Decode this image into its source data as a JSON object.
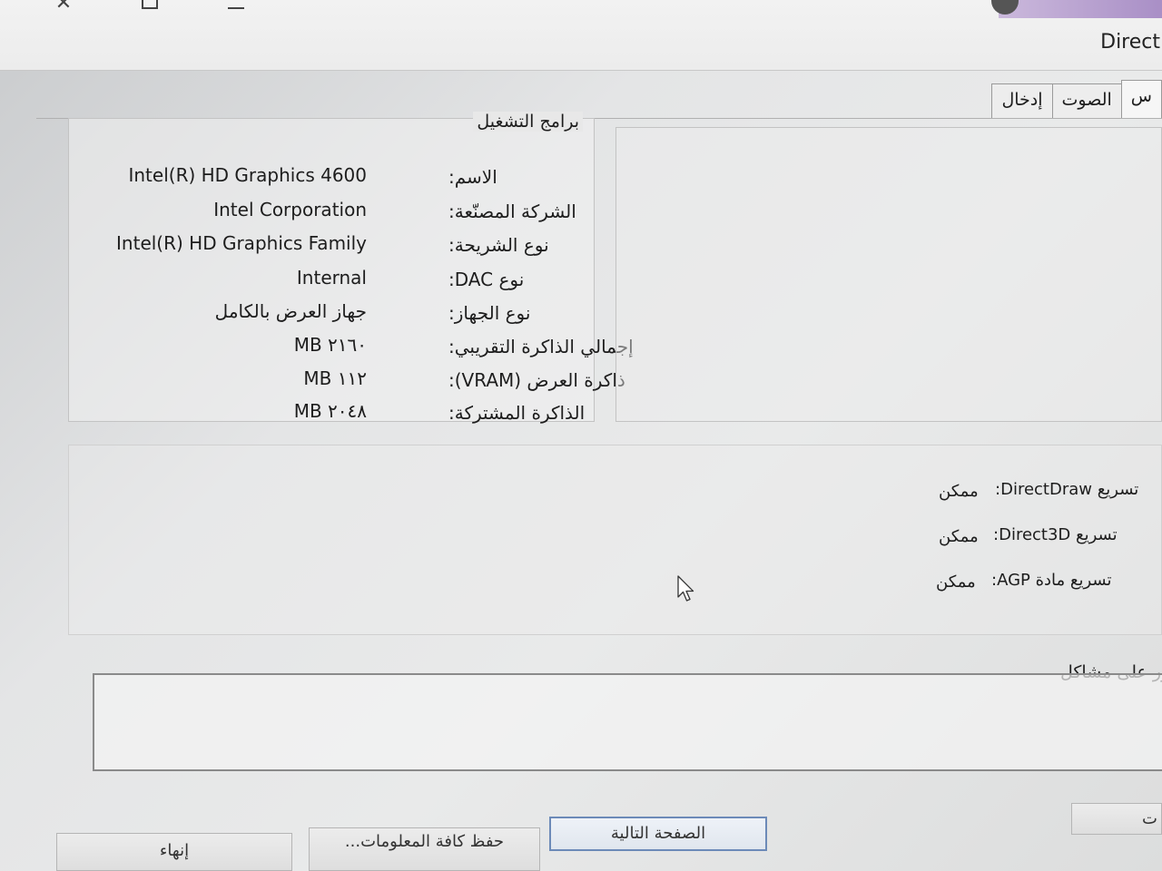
{
  "window": {
    "title": "Direct",
    "close_glyph": "✕"
  },
  "tabs": [
    {
      "label": "س",
      "active": true
    },
    {
      "label": "الصوت",
      "active": false
    },
    {
      "label": "إدخال",
      "active": false
    }
  ],
  "drivers": {
    "title": "برامج التشغيل",
    "rows": [
      {
        "label": "الاسم:",
        "value": "Intel(R) HD Graphics 4600"
      },
      {
        "label": "الشركة المصنّعة:",
        "value": "Intel Corporation"
      },
      {
        "label": "نوع الشريحة:",
        "value": "Intel(R) HD Graphics Family"
      },
      {
        "label": "نوع DAC:",
        "value": "Internal"
      },
      {
        "label": "نوع الجهاز:",
        "value": "جهاز العرض بالكامل"
      },
      {
        "label": "إجمالي الذاكرة التقريبي:",
        "value": "MB ٢١٦٠"
      },
      {
        "label": "ذاكرة العرض (VRAM):",
        "value": "MB ١١٢"
      },
      {
        "label": "الذاكرة المشتركة:",
        "value": "MB ٢٠٤٨"
      }
    ]
  },
  "features": {
    "rows": [
      {
        "label": "تسريع DirectDraw:",
        "value": "ممكن"
      },
      {
        "label": "تسريع Direct3D:",
        "value": "ممكن"
      },
      {
        "label": "تسريع مادة AGP:",
        "value": "ممكن"
      }
    ]
  },
  "notes": {
    "title": "عثور على مشاكل"
  },
  "buttons": {
    "help": "ت",
    "next": "الصفحة التالية",
    "save": "حفظ كافة المعلومات...",
    "exit": "إنهاء"
  },
  "colors": {
    "focus_border": "#6c8ab8",
    "tab_strip": "#a98fc6"
  }
}
